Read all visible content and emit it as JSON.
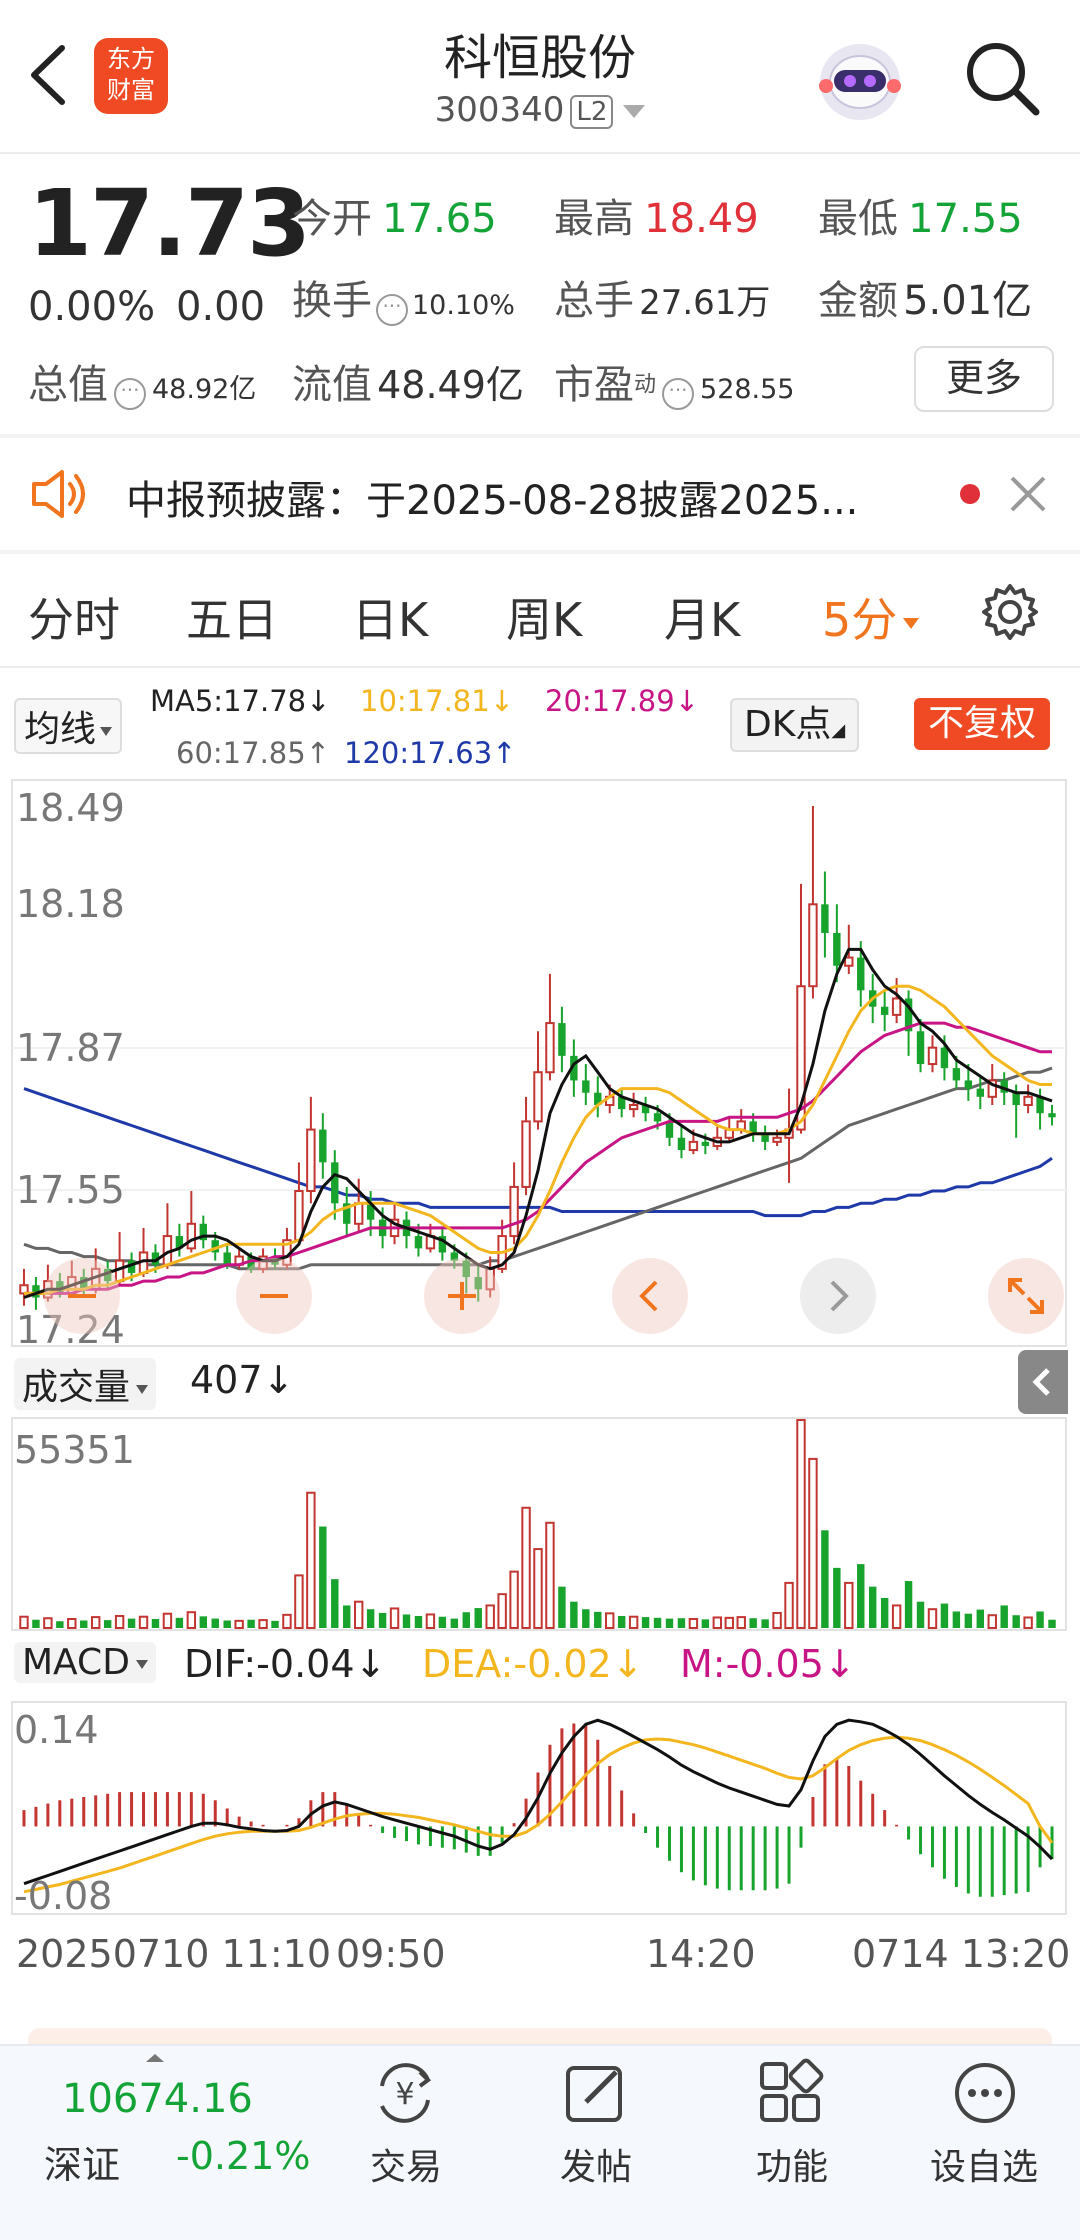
{
  "header": {
    "title": "科恒股份",
    "code": "300340",
    "level_badge": "L2",
    "logo_text_1": "东方",
    "logo_text_2": "财富"
  },
  "quote": {
    "price": "17.73",
    "change_pct": "0.00%",
    "change_amt": "0.00",
    "rows": [
      [
        {
          "label": "今开",
          "value": "17.65",
          "color": "green"
        },
        {
          "label": "最高",
          "value": "18.49",
          "color": "red"
        },
        {
          "label": "最低",
          "value": "17.55",
          "color": "green"
        }
      ],
      [
        {
          "label": "换手",
          "value": "10.10%",
          "color": "plain"
        },
        {
          "label": "总手",
          "value": "27.61万",
          "color": "plain"
        },
        {
          "label": "金额",
          "value": "5.01亿",
          "color": "plain"
        }
      ],
      [
        {
          "label": "流值",
          "value": "48.49亿",
          "color": "plain"
        },
        {
          "label": "市盈",
          "value": "528.55",
          "color": "plain"
        }
      ]
    ],
    "total_value_label": "总值",
    "total_value": "48.92亿",
    "pe_superscript": "动",
    "more_button": "更多"
  },
  "notice": {
    "text": "中报预披露：于2025-08-28披露2025..."
  },
  "tabs": [
    "分时",
    "五日",
    "日K",
    "周K",
    "月K",
    "5分"
  ],
  "active_tab_index": 5,
  "ma_legend": {
    "selector": "均线",
    "ma5": "MA5:17.78↓",
    "ma10": "10:17.81↓",
    "ma20": "20:17.89↓",
    "ma60": "60:17.85↑",
    "ma120": "120:17.63↑",
    "dk_button": "DK点",
    "fq_button": "不复权"
  },
  "colors": {
    "up": "#c23531",
    "down": "#17a32c",
    "accent": "#f0751e",
    "ma5": "#111111",
    "ma10": "#f3b61f",
    "ma20": "#c71585",
    "ma60": "#666666",
    "ma120": "#1f3aa8"
  },
  "price_axis": {
    "ticks": [
      "18.49",
      "18.18",
      "17.87",
      "17.55",
      "17.24"
    ],
    "ylim": [
      17.24,
      18.49
    ]
  },
  "volume": {
    "selector": "成交量",
    "current": "407↓",
    "max_label": "55351",
    "ylim": [
      0,
      55351
    ]
  },
  "macd": {
    "selector": "MACD",
    "dif": "DIF:-0.04↓",
    "dea": "DEA:-0.02↓",
    "m": "M:-0.05↓",
    "ticks": [
      "0.14",
      "-0.08"
    ]
  },
  "time_axis": [
    "20250710 11:10",
    "09:50",
    "14:20",
    "0714 13:20"
  ],
  "bottom_bar": {
    "index_value": "10674.16",
    "index_name": "深证",
    "index_change": "-0.21%",
    "items": [
      {
        "label": "交易",
        "icon": "yen-swap-icon"
      },
      {
        "label": "发帖",
        "icon": "edit-icon"
      },
      {
        "label": "功能",
        "icon": "grid-icon"
      },
      {
        "label": "设自选",
        "icon": "more-dots-icon"
      }
    ]
  },
  "chart_data": {
    "type": "candlestick",
    "interval": "5分",
    "ylim": [
      17.24,
      18.49
    ],
    "candles": [
      [
        17.3,
        17.32,
        17.36,
        17.27
      ],
      [
        17.32,
        17.29,
        17.34,
        17.26
      ],
      [
        17.29,
        17.33,
        17.37,
        17.28
      ],
      [
        17.33,
        17.3,
        17.35,
        17.29
      ],
      [
        17.3,
        17.34,
        17.38,
        17.29
      ],
      [
        17.34,
        17.31,
        17.36,
        17.29
      ],
      [
        17.31,
        17.36,
        17.41,
        17.3
      ],
      [
        17.36,
        17.33,
        17.38,
        17.31
      ],
      [
        17.33,
        17.38,
        17.45,
        17.32
      ],
      [
        17.38,
        17.35,
        17.4,
        17.33
      ],
      [
        17.35,
        17.4,
        17.46,
        17.34
      ],
      [
        17.4,
        17.37,
        17.42,
        17.35
      ],
      [
        17.37,
        17.44,
        17.52,
        17.36
      ],
      [
        17.44,
        17.41,
        17.47,
        17.39
      ],
      [
        17.41,
        17.47,
        17.55,
        17.4
      ],
      [
        17.47,
        17.43,
        17.49,
        17.41
      ],
      [
        17.43,
        17.4,
        17.45,
        17.38
      ],
      [
        17.4,
        17.37,
        17.42,
        17.36
      ],
      [
        17.37,
        17.39,
        17.41,
        17.36
      ],
      [
        17.39,
        17.36,
        17.4,
        17.35
      ],
      [
        17.36,
        17.39,
        17.41,
        17.35
      ],
      [
        17.39,
        17.37,
        17.41,
        17.36
      ],
      [
        17.37,
        17.43,
        17.46,
        17.36
      ],
      [
        17.43,
        17.55,
        17.62,
        17.42
      ],
      [
        17.55,
        17.7,
        17.78,
        17.52
      ],
      [
        17.7,
        17.62,
        17.74,
        17.58
      ],
      [
        17.62,
        17.52,
        17.65,
        17.48
      ],
      [
        17.52,
        17.47,
        17.56,
        17.44
      ],
      [
        17.47,
        17.52,
        17.58,
        17.45
      ],
      [
        17.52,
        17.48,
        17.55,
        17.44
      ],
      [
        17.48,
        17.44,
        17.51,
        17.41
      ],
      [
        17.44,
        17.48,
        17.52,
        17.42
      ],
      [
        17.48,
        17.44,
        17.5,
        17.41
      ],
      [
        17.44,
        17.41,
        17.47,
        17.39
      ],
      [
        17.41,
        17.44,
        17.47,
        17.4
      ],
      [
        17.44,
        17.4,
        17.46,
        17.38
      ],
      [
        17.4,
        17.38,
        17.42,
        17.36
      ],
      [
        17.38,
        17.34,
        17.4,
        17.3
      ],
      [
        17.34,
        17.31,
        17.37,
        17.28
      ],
      [
        17.31,
        17.36,
        17.39,
        17.29
      ],
      [
        17.36,
        17.44,
        17.48,
        17.35
      ],
      [
        17.44,
        17.56,
        17.62,
        17.42
      ],
      [
        17.56,
        17.72,
        17.78,
        17.54
      ],
      [
        17.72,
        17.84,
        17.94,
        17.7
      ],
      [
        17.84,
        17.96,
        18.08,
        17.82
      ],
      [
        17.96,
        17.88,
        18.0,
        17.84
      ],
      [
        17.88,
        17.82,
        17.92,
        17.78
      ],
      [
        17.82,
        17.79,
        17.86,
        17.76
      ],
      [
        17.79,
        17.76,
        17.83,
        17.73
      ],
      [
        17.76,
        17.78,
        17.81,
        17.74
      ],
      [
        17.78,
        17.75,
        17.8,
        17.73
      ],
      [
        17.75,
        17.76,
        17.79,
        17.73
      ],
      [
        17.76,
        17.74,
        17.78,
        17.72
      ],
      [
        17.74,
        17.72,
        17.76,
        17.7
      ],
      [
        17.72,
        17.68,
        17.74,
        17.66
      ],
      [
        17.68,
        17.65,
        17.71,
        17.63
      ],
      [
        17.65,
        17.67,
        17.7,
        17.64
      ],
      [
        17.67,
        17.66,
        17.69,
        17.64
      ],
      [
        17.66,
        17.68,
        17.71,
        17.65
      ],
      [
        17.68,
        17.7,
        17.73,
        17.67
      ],
      [
        17.7,
        17.72,
        17.75,
        17.69
      ],
      [
        17.72,
        17.69,
        17.74,
        17.67
      ],
      [
        17.69,
        17.67,
        17.71,
        17.65
      ],
      [
        17.67,
        17.68,
        17.7,
        17.66
      ],
      [
        17.68,
        17.7,
        17.8,
        17.57
      ],
      [
        17.7,
        18.05,
        18.3,
        17.69
      ],
      [
        18.05,
        18.25,
        18.49,
        18.02
      ],
      [
        18.25,
        18.18,
        18.33,
        18.12
      ],
      [
        18.18,
        18.1,
        18.25,
        18.06
      ],
      [
        18.1,
        18.12,
        18.2,
        18.08
      ],
      [
        18.12,
        18.04,
        18.16,
        18.0
      ],
      [
        18.04,
        18.0,
        18.08,
        17.96
      ],
      [
        18.0,
        17.98,
        18.04,
        17.94
      ],
      [
        17.98,
        18.02,
        18.07,
        17.96
      ],
      [
        18.02,
        17.94,
        18.04,
        17.88
      ],
      [
        17.94,
        17.86,
        17.97,
        17.84
      ],
      [
        17.86,
        17.9,
        17.93,
        17.84
      ],
      [
        17.9,
        17.85,
        17.93,
        17.82
      ],
      [
        17.85,
        17.82,
        17.88,
        17.8
      ],
      [
        17.82,
        17.8,
        17.86,
        17.77
      ],
      [
        17.8,
        17.78,
        17.83,
        17.75
      ],
      [
        17.78,
        17.82,
        17.86,
        17.76
      ],
      [
        17.82,
        17.79,
        17.84,
        17.76
      ],
      [
        17.79,
        17.76,
        17.81,
        17.68
      ],
      [
        17.76,
        17.78,
        17.81,
        17.74
      ],
      [
        17.78,
        17.74,
        17.8,
        17.7
      ],
      [
        17.74,
        17.73,
        17.76,
        17.71
      ]
    ],
    "ma5": [
      17.29,
      17.3,
      17.31,
      17.31,
      17.32,
      17.33,
      17.34,
      17.35,
      17.36,
      17.37,
      17.38,
      17.38,
      17.4,
      17.41,
      17.43,
      17.44,
      17.44,
      17.43,
      17.41,
      17.39,
      17.38,
      17.38,
      17.39,
      17.42,
      17.5,
      17.56,
      17.59,
      17.58,
      17.55,
      17.52,
      17.49,
      17.47,
      17.46,
      17.45,
      17.44,
      17.43,
      17.41,
      17.39,
      17.37,
      17.36,
      17.37,
      17.4,
      17.49,
      17.6,
      17.74,
      17.81,
      17.86,
      17.88,
      17.84,
      17.8,
      17.78,
      17.77,
      17.76,
      17.75,
      17.73,
      17.71,
      17.69,
      17.68,
      17.67,
      17.67,
      17.68,
      17.69,
      17.69,
      17.69,
      17.69,
      17.76,
      17.86,
      17.99,
      18.08,
      18.14,
      18.14,
      18.09,
      18.05,
      18.03,
      18.0,
      17.96,
      17.94,
      17.91,
      17.87,
      17.85,
      17.83,
      17.81,
      17.8,
      17.79,
      17.79,
      17.78,
      17.77
    ],
    "ma10": [
      17.3,
      17.3,
      17.3,
      17.31,
      17.31,
      17.31,
      17.32,
      17.32,
      17.33,
      17.34,
      17.35,
      17.36,
      17.37,
      17.38,
      17.39,
      17.4,
      17.41,
      17.42,
      17.42,
      17.42,
      17.42,
      17.42,
      17.42,
      17.43,
      17.45,
      17.48,
      17.5,
      17.51,
      17.52,
      17.52,
      17.52,
      17.52,
      17.51,
      17.5,
      17.49,
      17.47,
      17.45,
      17.43,
      17.41,
      17.4,
      17.4,
      17.41,
      17.44,
      17.49,
      17.55,
      17.62,
      17.68,
      17.73,
      17.76,
      17.78,
      17.8,
      17.8,
      17.8,
      17.8,
      17.79,
      17.77,
      17.75,
      17.73,
      17.71,
      17.7,
      17.7,
      17.69,
      17.69,
      17.69,
      17.7,
      17.72,
      17.76,
      17.82,
      17.88,
      17.94,
      17.99,
      18.02,
      18.04,
      18.05,
      18.05,
      18.04,
      18.02,
      18.0,
      17.97,
      17.94,
      17.91,
      17.88,
      17.86,
      17.84,
      17.82,
      17.81,
      17.81
    ],
    "ma20": [
      17.3,
      17.3,
      17.3,
      17.3,
      17.3,
      17.31,
      17.31,
      17.31,
      17.32,
      17.32,
      17.33,
      17.33,
      17.34,
      17.34,
      17.35,
      17.35,
      17.36,
      17.37,
      17.37,
      17.38,
      17.38,
      17.39,
      17.39,
      17.4,
      17.41,
      17.42,
      17.43,
      17.44,
      17.45,
      17.46,
      17.46,
      17.46,
      17.46,
      17.46,
      17.46,
      17.46,
      17.46,
      17.46,
      17.46,
      17.46,
      17.46,
      17.47,
      17.48,
      17.5,
      17.53,
      17.56,
      17.59,
      17.62,
      17.64,
      17.66,
      17.68,
      17.69,
      17.7,
      17.71,
      17.72,
      17.72,
      17.72,
      17.72,
      17.72,
      17.73,
      17.73,
      17.73,
      17.73,
      17.73,
      17.74,
      17.75,
      17.77,
      17.8,
      17.83,
      17.86,
      17.89,
      17.91,
      17.93,
      17.94,
      17.95,
      17.96,
      17.96,
      17.96,
      17.95,
      17.95,
      17.94,
      17.93,
      17.92,
      17.91,
      17.9,
      17.89,
      17.89
    ],
    "ma60": [
      17.42,
      17.41,
      17.41,
      17.4,
      17.4,
      17.39,
      17.39,
      17.38,
      17.38,
      17.38,
      17.37,
      17.37,
      17.37,
      17.37,
      17.37,
      17.37,
      17.37,
      17.37,
      17.36,
      17.36,
      17.36,
      17.36,
      17.36,
      17.36,
      17.37,
      17.37,
      17.37,
      17.37,
      17.37,
      17.37,
      17.37,
      17.37,
      17.37,
      17.37,
      17.37,
      17.37,
      17.37,
      17.37,
      17.37,
      17.38,
      17.38,
      17.39,
      17.4,
      17.41,
      17.42,
      17.43,
      17.44,
      17.45,
      17.46,
      17.47,
      17.48,
      17.49,
      17.5,
      17.51,
      17.52,
      17.53,
      17.54,
      17.55,
      17.56,
      17.57,
      17.58,
      17.59,
      17.6,
      17.61,
      17.62,
      17.63,
      17.65,
      17.67,
      17.69,
      17.71,
      17.72,
      17.73,
      17.74,
      17.75,
      17.76,
      17.77,
      17.78,
      17.79,
      17.8,
      17.8,
      17.81,
      17.82,
      17.82,
      17.83,
      17.84,
      17.84,
      17.85
    ],
    "ma120": [
      17.8,
      17.79,
      17.78,
      17.77,
      17.76,
      17.75,
      17.74,
      17.73,
      17.72,
      17.71,
      17.7,
      17.69,
      17.68,
      17.67,
      17.66,
      17.65,
      17.64,
      17.63,
      17.62,
      17.61,
      17.6,
      17.59,
      17.58,
      17.57,
      17.56,
      17.56,
      17.55,
      17.54,
      17.54,
      17.53,
      17.53,
      17.52,
      17.52,
      17.52,
      17.51,
      17.51,
      17.51,
      17.51,
      17.51,
      17.51,
      17.51,
      17.51,
      17.51,
      17.51,
      17.51,
      17.5,
      17.5,
      17.5,
      17.5,
      17.5,
      17.5,
      17.5,
      17.5,
      17.5,
      17.5,
      17.5,
      17.5,
      17.5,
      17.5,
      17.5,
      17.5,
      17.5,
      17.49,
      17.49,
      17.49,
      17.49,
      17.5,
      17.5,
      17.51,
      17.51,
      17.52,
      17.52,
      17.53,
      17.53,
      17.54,
      17.54,
      17.55,
      17.55,
      17.56,
      17.56,
      17.57,
      17.57,
      17.58,
      17.59,
      17.6,
      17.61,
      17.63
    ],
    "volume": [
      3000,
      2200,
      2600,
      1800,
      2400,
      2000,
      2900,
      2100,
      3200,
      2500,
      3000,
      2400,
      3800,
      2700,
      4200,
      3100,
      2500,
      2000,
      1900,
      2200,
      2100,
      1900,
      3500,
      14000,
      36000,
      27000,
      13000,
      6000,
      7000,
      5000,
      4000,
      5200,
      3600,
      3200,
      3600,
      3000,
      2500,
      4200,
      5300,
      6000,
      9000,
      15000,
      32000,
      21000,
      28000,
      11000,
      7000,
      5000,
      4300,
      3900,
      3200,
      3000,
      2900,
      2700,
      2500,
      2600,
      2400,
      2300,
      2800,
      2700,
      2900,
      2600,
      2300,
      4000,
      12000,
      55351,
      45000,
      26000,
      16000,
      12000,
      17000,
      11000,
      8000,
      6000,
      12500,
      7000,
      5000,
      6500,
      4400,
      3800,
      4900,
      3400,
      6000,
      3400,
      2800,
      4400,
      2200
    ],
    "macd_dif": [
      -0.07,
      -0.065,
      -0.06,
      -0.055,
      -0.05,
      -0.045,
      -0.04,
      -0.035,
      -0.03,
      -0.025,
      -0.02,
      -0.015,
      -0.01,
      -0.005,
      0.0,
      0.004,
      0.004,
      0.002,
      -0.001,
      -0.003,
      -0.005,
      -0.006,
      -0.005,
      0.0,
      0.015,
      0.025,
      0.03,
      0.027,
      0.022,
      0.017,
      0.012,
      0.008,
      0.004,
      0.0,
      -0.004,
      -0.008,
      -0.012,
      -0.018,
      -0.024,
      -0.028,
      -0.022,
      -0.01,
      0.01,
      0.035,
      0.065,
      0.09,
      0.11,
      0.125,
      0.13,
      0.125,
      0.118,
      0.11,
      0.102,
      0.094,
      0.085,
      0.075,
      0.067,
      0.06,
      0.053,
      0.047,
      0.042,
      0.037,
      0.032,
      0.027,
      0.025,
      0.045,
      0.08,
      0.11,
      0.125,
      0.13,
      0.128,
      0.125,
      0.118,
      0.11,
      0.1,
      0.088,
      0.075,
      0.062,
      0.05,
      0.038,
      0.027,
      0.017,
      0.008,
      -0.002,
      -0.012,
      -0.025,
      -0.04
    ],
    "macd_dea": [
      -0.08,
      -0.077,
      -0.074,
      -0.071,
      -0.067,
      -0.063,
      -0.059,
      -0.055,
      -0.051,
      -0.046,
      -0.041,
      -0.036,
      -0.031,
      -0.026,
      -0.021,
      -0.016,
      -0.012,
      -0.009,
      -0.007,
      -0.006,
      -0.006,
      -0.006,
      -0.006,
      -0.005,
      -0.001,
      0.004,
      0.009,
      0.013,
      0.015,
      0.016,
      0.016,
      0.015,
      0.013,
      0.011,
      0.008,
      0.005,
      0.002,
      -0.002,
      -0.006,
      -0.01,
      -0.012,
      -0.012,
      -0.007,
      0.002,
      0.015,
      0.03,
      0.047,
      0.063,
      0.077,
      0.088,
      0.096,
      0.102,
      0.106,
      0.107,
      0.106,
      0.103,
      0.1,
      0.096,
      0.091,
      0.086,
      0.081,
      0.076,
      0.071,
      0.065,
      0.06,
      0.058,
      0.062,
      0.072,
      0.083,
      0.093,
      0.1,
      0.105,
      0.108,
      0.109,
      0.108,
      0.105,
      0.1,
      0.094,
      0.087,
      0.079,
      0.07,
      0.06,
      0.05,
      0.039,
      0.028,
      0.0,
      -0.02
    ]
  }
}
